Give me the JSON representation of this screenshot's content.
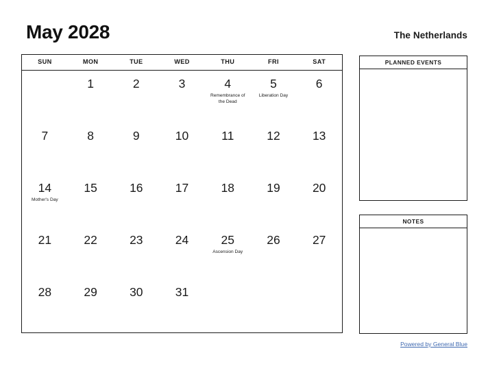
{
  "header": {
    "month_title": "May 2028",
    "country": "The Netherlands"
  },
  "calendar": {
    "weekday_headers": [
      "SUN",
      "MON",
      "TUE",
      "WED",
      "THU",
      "FRI",
      "SAT"
    ],
    "weeks": [
      [
        {
          "day": "",
          "event": ""
        },
        {
          "day": "1",
          "event": ""
        },
        {
          "day": "2",
          "event": ""
        },
        {
          "day": "3",
          "event": ""
        },
        {
          "day": "4",
          "event": "Remembrance of the Dead"
        },
        {
          "day": "5",
          "event": "Liberation Day"
        },
        {
          "day": "6",
          "event": ""
        }
      ],
      [
        {
          "day": "7",
          "event": ""
        },
        {
          "day": "8",
          "event": ""
        },
        {
          "day": "9",
          "event": ""
        },
        {
          "day": "10",
          "event": ""
        },
        {
          "day": "11",
          "event": ""
        },
        {
          "day": "12",
          "event": ""
        },
        {
          "day": "13",
          "event": ""
        }
      ],
      [
        {
          "day": "14",
          "event": "Mother's Day"
        },
        {
          "day": "15",
          "event": ""
        },
        {
          "day": "16",
          "event": ""
        },
        {
          "day": "17",
          "event": ""
        },
        {
          "day": "18",
          "event": ""
        },
        {
          "day": "19",
          "event": ""
        },
        {
          "day": "20",
          "event": ""
        }
      ],
      [
        {
          "day": "21",
          "event": ""
        },
        {
          "day": "22",
          "event": ""
        },
        {
          "day": "23",
          "event": ""
        },
        {
          "day": "24",
          "event": ""
        },
        {
          "day": "25",
          "event": "Ascension Day"
        },
        {
          "day": "26",
          "event": ""
        },
        {
          "day": "27",
          "event": ""
        }
      ],
      [
        {
          "day": "28",
          "event": ""
        },
        {
          "day": "29",
          "event": ""
        },
        {
          "day": "30",
          "event": ""
        },
        {
          "day": "31",
          "event": ""
        },
        {
          "day": "",
          "event": ""
        },
        {
          "day": "",
          "event": ""
        },
        {
          "day": "",
          "event": ""
        }
      ]
    ]
  },
  "panels": {
    "planned_events": {
      "title": "PLANNED EVENTS",
      "content": ""
    },
    "notes": {
      "title": "NOTES",
      "content": ""
    }
  },
  "footer": {
    "link_text": "Powered by General Blue",
    "link_color": "#3f69b0"
  }
}
